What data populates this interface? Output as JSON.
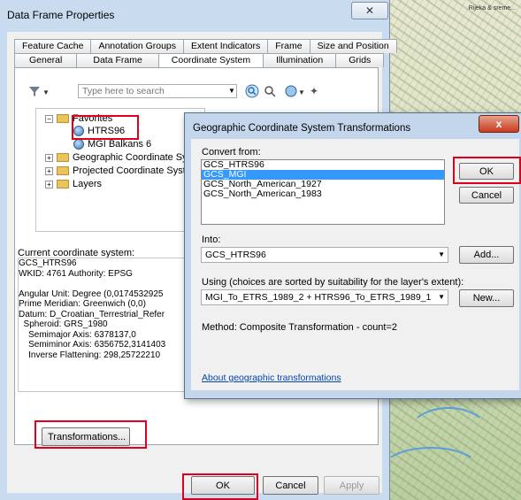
{
  "map": {
    "label": "Rijeka & sreme..."
  },
  "data_frame_properties": {
    "title": "Data Frame Properties",
    "close_glyph": "✕",
    "tabs_row1": [
      "Feature Cache",
      "Annotation Groups",
      "Extent Indicators",
      "Frame",
      "Size and Position"
    ],
    "tabs_row2": [
      "General",
      "Data Frame",
      "Coordinate System",
      "Illumination",
      "Grids"
    ],
    "active_tab": "Coordinate System",
    "search_placeholder": "Type here to search",
    "tree": {
      "favorites": "Favorites",
      "htrs96": "HTRS96",
      "mgi_balkans6": "MGI Balkans 6",
      "geographic": "Geographic Coordinate Sys",
      "projected": "Projected Coordinate Syste",
      "layers": "Layers"
    },
    "current_label": "Current coordinate system:",
    "current_text": "GCS_HTRS96\nWKID: 4761 Authority: EPSG\n\nAngular Unit: Degree (0,0174532925\nPrime Meridian: Greenwich (0,0)\nDatum: D_Croatian_Terrestrial_Refer\n  Spheroid: GRS_1980\n    Semimajor Axis: 6378137,0\n    Semiminor Axis: 6356752,3141403\n    Inverse Flattening: 298,25722210",
    "transformations_button": "Transformations...",
    "ok_button": "OK",
    "cancel_button": "Cancel",
    "apply_button": "Apply"
  },
  "gcs_dialog": {
    "title": "Geographic Coordinate System Transformations",
    "close_glyph": "x",
    "convert_from_label": "Convert from:",
    "convert_from_items": [
      "GCS_HTRS96",
      "GCS_MGI",
      "GCS_North_American_1927",
      "GCS_North_American_1983"
    ],
    "selected_index": 1,
    "ok_button": "OK",
    "cancel_button": "Cancel",
    "into_label": "Into:",
    "into_value": "GCS_HTRS96",
    "add_button": "Add...",
    "using_label": "Using (choices are sorted by suitability for the layer's extent):",
    "using_value": "MGI_To_ETRS_1989_2 + HTRS96_To_ETRS_1989_1",
    "new_button": "New...",
    "method_text": "Method:  Composite Transformation - count=2",
    "link_text": "About geographic transformations"
  }
}
